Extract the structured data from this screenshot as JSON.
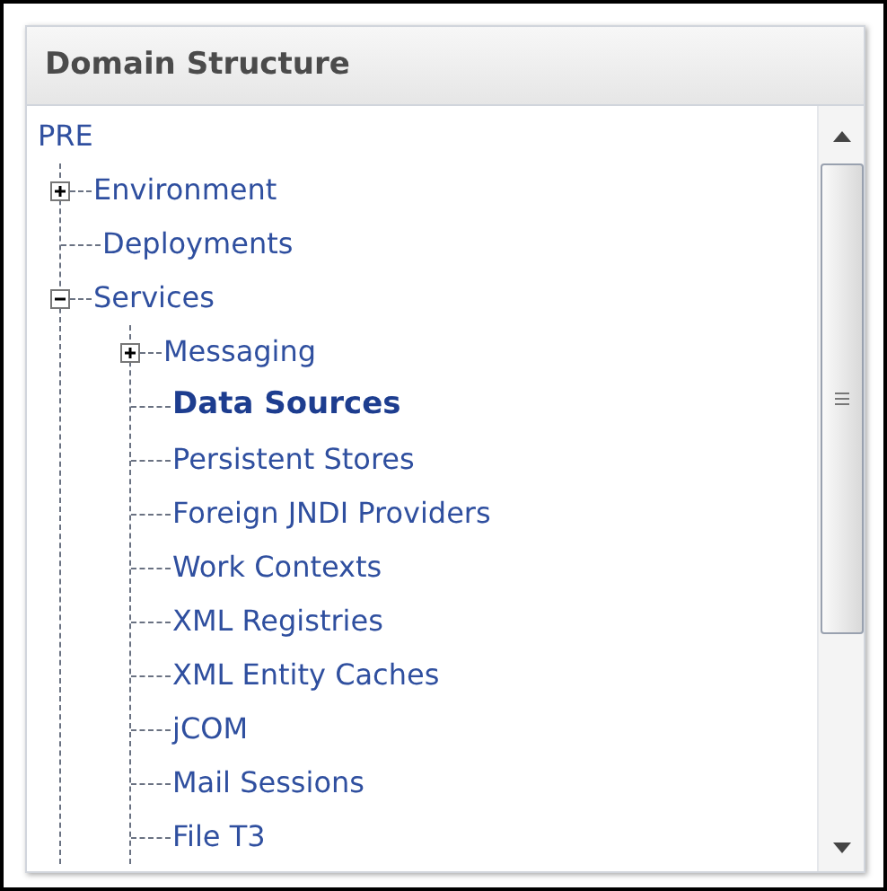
{
  "panel": {
    "title": "Domain Structure"
  },
  "tree": [
    {
      "label": "PRE",
      "selected": false,
      "children": [
        {
          "label": "Environment",
          "selected": false,
          "expanded": false
        },
        {
          "label": "Deployments",
          "selected": false
        },
        {
          "label": "Services",
          "selected": false,
          "expanded": true,
          "children": [
            {
              "label": "Messaging",
              "selected": false,
              "expanded": false
            },
            {
              "label": "Data Sources",
              "selected": true
            },
            {
              "label": "Persistent Stores",
              "selected": false
            },
            {
              "label": "Foreign JNDI Providers",
              "selected": false
            },
            {
              "label": "Work Contexts",
              "selected": false
            },
            {
              "label": "XML Registries",
              "selected": false
            },
            {
              "label": "XML Entity Caches",
              "selected": false
            },
            {
              "label": "jCOM",
              "selected": false
            },
            {
              "label": "Mail Sessions",
              "selected": false
            },
            {
              "label": "File T3",
              "selected": false
            }
          ]
        }
      ]
    }
  ]
}
